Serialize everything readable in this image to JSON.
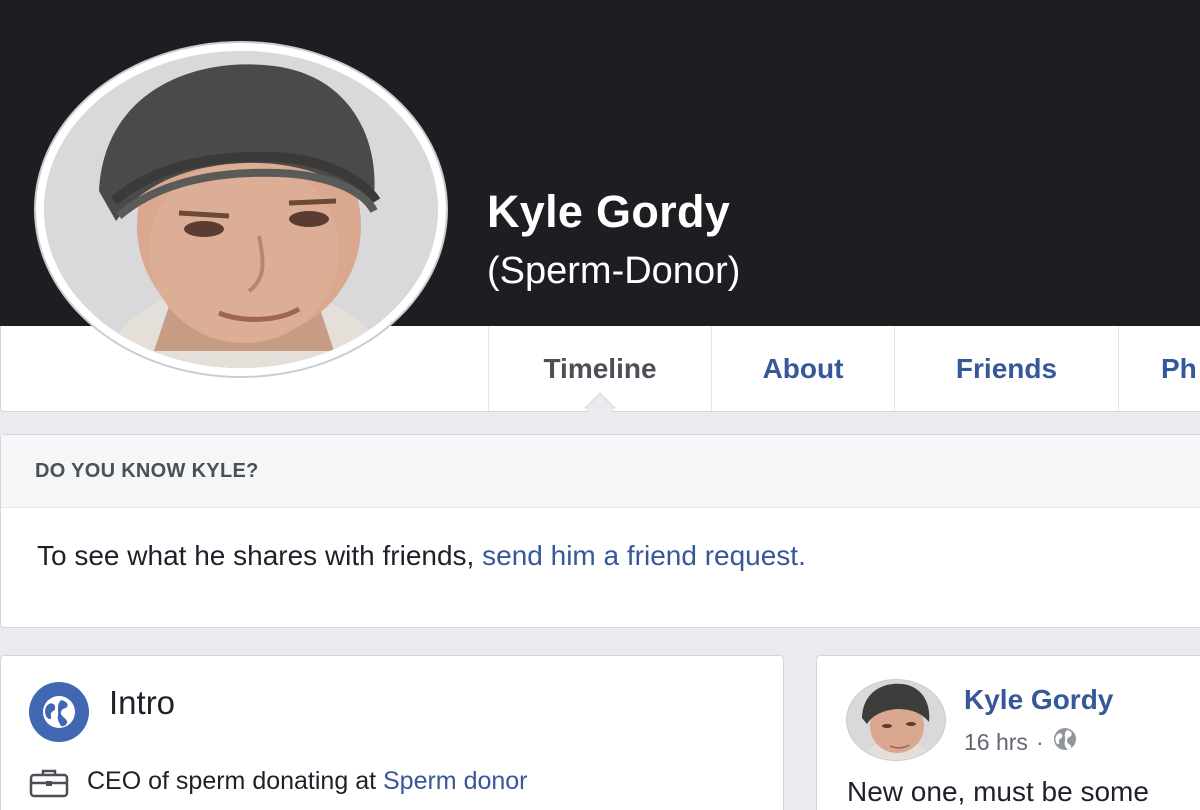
{
  "profile": {
    "name": "Kyle Gordy",
    "subtitle": "(Sperm-Donor)"
  },
  "tabs": [
    {
      "label": "Timeline",
      "active": true
    },
    {
      "label": "About",
      "active": false
    },
    {
      "label": "Friends",
      "active": false
    },
    {
      "label": "Ph",
      "active": false
    }
  ],
  "know_card": {
    "header": "DO YOU KNOW KYLE?",
    "text": "To see what he shares with friends, ",
    "link": "send him a friend request."
  },
  "intro": {
    "title": "Intro",
    "work_text": "CEO of sperm donating at ",
    "work_link": "Sperm donor"
  },
  "post": {
    "author": "Kyle Gordy",
    "time": "16 hrs",
    "separator": "·",
    "text": "New one, must be some"
  },
  "colors": {
    "cover": "#1d1e22",
    "link": "#365899",
    "page_bg": "#e9ebee",
    "badge": "#4267b2"
  },
  "icons": [
    "globe-icon",
    "briefcase-icon",
    "public-globe-icon"
  ]
}
